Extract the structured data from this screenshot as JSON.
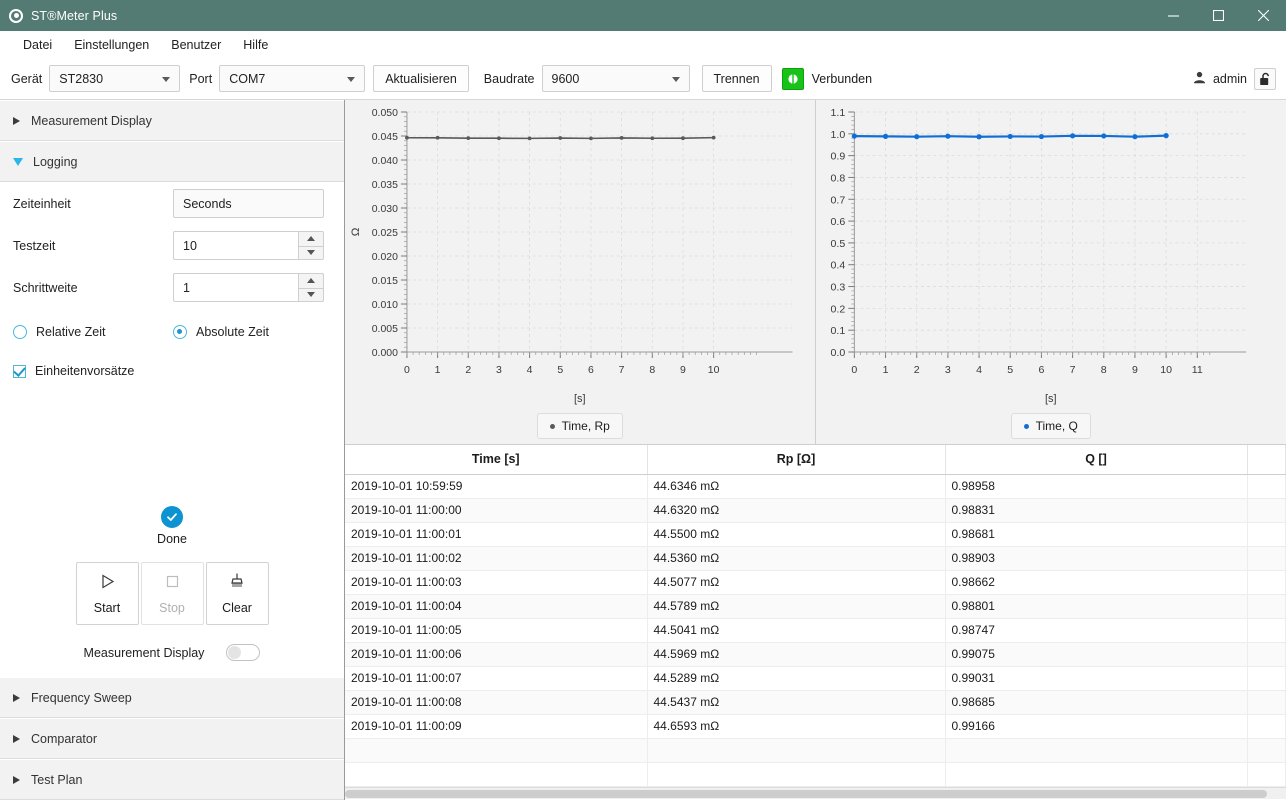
{
  "window": {
    "title": "ST®Meter Plus",
    "app_icon": "radio-target-icon",
    "minimize": "–",
    "maximize": "□",
    "close": "✕",
    "titlebar_color": "#537b73"
  },
  "menubar": {
    "items": [
      "Datei",
      "Einstellungen",
      "Benutzer",
      "Hilfe"
    ]
  },
  "toolbar": {
    "device_label": "Gerät",
    "device_value": "ST2830",
    "port_label": "Port",
    "port_value": "COM7",
    "refresh_button": "Aktualisieren",
    "baudrate_label": "Baudrate",
    "baudrate_value": "9600",
    "disconnect_button": "Trennen",
    "connection_icon": "connected-plug-icon",
    "connection_status": "Verbunden",
    "connection_color": "#16c316",
    "user_icon": "user-icon",
    "user_name": "admin",
    "lock_icon": "unlocked-padlock-icon"
  },
  "sidebar": {
    "sections": [
      {
        "label": "Measurement Display",
        "expanded": false
      },
      {
        "label": "Logging",
        "expanded": true
      },
      {
        "label": "Frequency Sweep",
        "expanded": false
      },
      {
        "label": "Comparator",
        "expanded": false
      },
      {
        "label": "Test Plan",
        "expanded": false
      }
    ],
    "logging": {
      "time_unit_label": "Zeiteinheit",
      "time_unit_value": "Seconds",
      "test_time_label": "Testzeit",
      "test_time_value": "10",
      "step_label": "Schrittweite",
      "step_value": "1",
      "relative_time_label": "Relative Zeit",
      "relative_time_checked": false,
      "absolute_time_label": "Absolute Zeit",
      "absolute_time_checked": true,
      "unit_prefix_label": "Einheitenvorsätze",
      "unit_prefix_checked": true,
      "status_icon": "check-circle-icon",
      "status_label": "Done",
      "status_color": "#0d93d2",
      "start_button": "Start",
      "start_icon": "play-triangle-icon",
      "stop_button": "Stop",
      "stop_icon": "stop-square-icon",
      "stop_disabled": true,
      "clear_button": "Clear",
      "clear_icon": "broom-icon",
      "measurement_display_label": "Measurement Display",
      "measurement_display_toggle": false
    }
  },
  "chart_data": [
    {
      "id": "chart-rp",
      "type": "line",
      "title": "",
      "xlabel": "[s]",
      "ylabel": "Ω",
      "ylabel_rotated": true,
      "xlim": [
        0,
        11.4
      ],
      "ylim": [
        0.0,
        0.05
      ],
      "xticks": [
        0,
        1,
        2,
        3,
        4,
        5,
        6,
        7,
        8,
        9,
        10
      ],
      "yticks": [
        "0.000",
        "0.005",
        "0.010",
        "0.015",
        "0.020",
        "0.025",
        "0.030",
        "0.035",
        "0.040",
        "0.045",
        "0.050"
      ],
      "grid": true,
      "legend_position": "bottom",
      "series": [
        {
          "name": "Time, Rp",
          "color": "#5a5a5a",
          "marker": "circle",
          "x": [
            0,
            1,
            2,
            3,
            4,
            5,
            6,
            7,
            8,
            9,
            10
          ],
          "y": [
            0.0446346,
            0.044632,
            0.04455,
            0.044536,
            0.0445077,
            0.0445789,
            0.0445041,
            0.0445969,
            0.0445289,
            0.0445437,
            0.0446593
          ]
        }
      ]
    },
    {
      "id": "chart-q",
      "type": "line",
      "title": "",
      "xlabel": "[s]",
      "ylabel": "",
      "xlim": [
        0,
        11.4
      ],
      "ylim": [
        0.0,
        1.1
      ],
      "xticks": [
        0,
        1,
        2,
        3,
        4,
        5,
        6,
        7,
        8,
        9,
        10,
        11
      ],
      "yticks": [
        "0.0",
        "0.1",
        "0.2",
        "0.3",
        "0.4",
        "0.5",
        "0.6",
        "0.7",
        "0.8",
        "0.9",
        "1.0",
        "1.1"
      ],
      "grid": true,
      "legend_position": "bottom",
      "series": [
        {
          "name": "Time, Q",
          "color": "#0f6fd6",
          "marker": "circle",
          "x": [
            0,
            1,
            2,
            3,
            4,
            5,
            6,
            7,
            8,
            9,
            10
          ],
          "y": [
            0.98958,
            0.98831,
            0.98681,
            0.98903,
            0.98662,
            0.98801,
            0.98747,
            0.99075,
            0.99031,
            0.98685,
            0.99166
          ]
        }
      ]
    }
  ],
  "table": {
    "columns": [
      "Time [s]",
      "Rp [Ω]",
      "Q []",
      ""
    ],
    "rows": [
      [
        "2019-10-01 10:59:59",
        "44.6346 mΩ",
        "0.98958",
        ""
      ],
      [
        "2019-10-01 11:00:00",
        "44.6320 mΩ",
        "0.98831",
        ""
      ],
      [
        "2019-10-01 11:00:01",
        "44.5500 mΩ",
        "0.98681",
        ""
      ],
      [
        "2019-10-01 11:00:02",
        "44.5360 mΩ",
        "0.98903",
        ""
      ],
      [
        "2019-10-01 11:00:03",
        "44.5077 mΩ",
        "0.98662",
        ""
      ],
      [
        "2019-10-01 11:00:04",
        "44.5789 mΩ",
        "0.98801",
        ""
      ],
      [
        "2019-10-01 11:00:05",
        "44.5041 mΩ",
        "0.98747",
        ""
      ],
      [
        "2019-10-01 11:00:06",
        "44.5969 mΩ",
        "0.99075",
        ""
      ],
      [
        "2019-10-01 11:00:07",
        "44.5289 mΩ",
        "0.99031",
        ""
      ],
      [
        "2019-10-01 11:00:08",
        "44.5437 mΩ",
        "0.98685",
        ""
      ],
      [
        "2019-10-01 11:00:09",
        "44.6593 mΩ",
        "0.99166",
        ""
      ],
      [
        "",
        "",
        "",
        ""
      ],
      [
        "",
        "",
        "",
        ""
      ]
    ]
  }
}
